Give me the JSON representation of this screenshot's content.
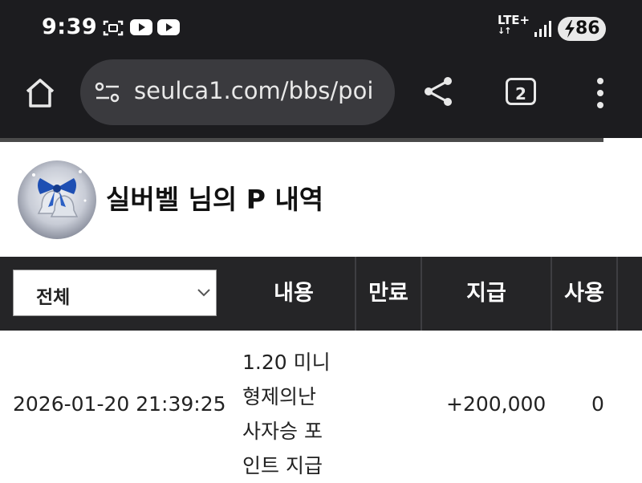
{
  "status_bar": {
    "time": "9:39",
    "network": "LTE+",
    "battery": "86"
  },
  "browser": {
    "url": "seulca1.com/bbs/poi",
    "tab_count": "2"
  },
  "page": {
    "title": "실버벨 님의 P 내역"
  },
  "table": {
    "filter_value": "전체",
    "headers": {
      "content": "내용",
      "expire": "만료",
      "give": "지급",
      "use": "사용"
    },
    "rows": [
      {
        "date": "2026-01-20 21:39:25",
        "content_lines": [
          "1.20 미니",
          "형제의난",
          "사자승 포",
          "인트 지급"
        ],
        "expire": "",
        "give": "+200,000",
        "use": "0"
      }
    ]
  },
  "colors": {
    "chrome_bg": "#1c1c1f",
    "urlbar_bg": "#3a3a3e",
    "table_header_bg": "#252527"
  }
}
